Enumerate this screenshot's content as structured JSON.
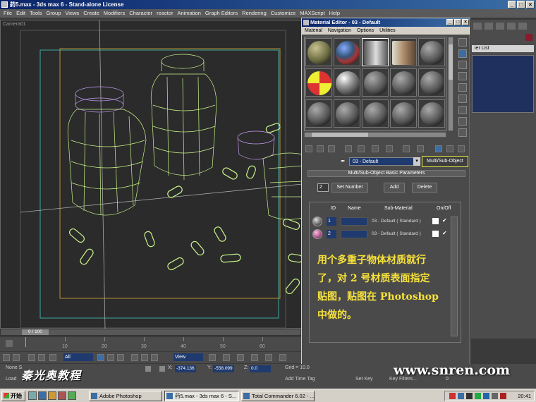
{
  "window": {
    "title": "药5.max - 3ds max 6 - Stand-alone License"
  },
  "menubar": [
    "File",
    "Edit",
    "Tools",
    "Group",
    "Views",
    "Create",
    "Modifiers",
    "Character",
    "reactor",
    "Animation",
    "Graph Editors",
    "Rendering",
    "Customize",
    "MAXScript",
    "Help"
  ],
  "viewport": {
    "label": "Camera01"
  },
  "command_panel": {
    "list_label": "ier List"
  },
  "material_editor": {
    "title": "Material Editor - 03 - Default",
    "menu": [
      "Material",
      "Navigation",
      "Options",
      "Utilities"
    ],
    "material_name": "03 - Default",
    "material_type": "Multi/Sub-Object",
    "rollout_title": "Multi/Sub-Object Basic Parameters",
    "set_number_value": "2",
    "set_number_label": "Set Number",
    "add_label": "Add",
    "delete_label": "Delete",
    "columns": {
      "id": "ID",
      "name": "Name",
      "sub_material": "Sub-Material",
      "on_off": "On/Off"
    },
    "rows": [
      {
        "id": "1",
        "sub_material": "03 - Default  ( Standard )",
        "check": "✔"
      },
      {
        "id": "2",
        "sub_material": "03 - Default  ( Standard )",
        "check": "✔"
      }
    ],
    "note_lines": [
      "用个多重子物体材质就行",
      "了，对 2 号材质表面指定",
      "贴图，贴图在 Photoshop",
      "中做的。"
    ]
  },
  "timeline": {
    "frame_label": "0 / 100",
    "ticks": [
      "10",
      "20",
      "30",
      "40",
      "50",
      "60"
    ]
  },
  "bottom_toolbar": {
    "selection_filter": "All",
    "coordinate_system": "View"
  },
  "status": {
    "selection": "None S",
    "loading": "Load",
    "x_label": "X:",
    "x_value": "-374.136",
    "y_label": "Y:",
    "y_value": "-558.099",
    "z_label": "Z:",
    "z_value": "0.0",
    "grid": "Grid = 10.0",
    "add_time_tag": "Add Time Tag",
    "set_key": "Set Key",
    "key_filters": "Key Filters...",
    "frame_value": "0"
  },
  "logo_text": "秦光奥教程",
  "watermark": "www.snren.com",
  "taskbar": {
    "start_label": "开始",
    "tasks": [
      "Adobe Photoshop",
      "药5.max - 3ds max 6 - S...",
      "Total Commander 6.02 - ..."
    ],
    "clock": "20:41"
  },
  "colors": {
    "wireframe_green": "#c9f58a",
    "wireframe_purple": "#c39bf2",
    "note_yellow": "#f7e23a",
    "title_blue": "#0a246a"
  }
}
